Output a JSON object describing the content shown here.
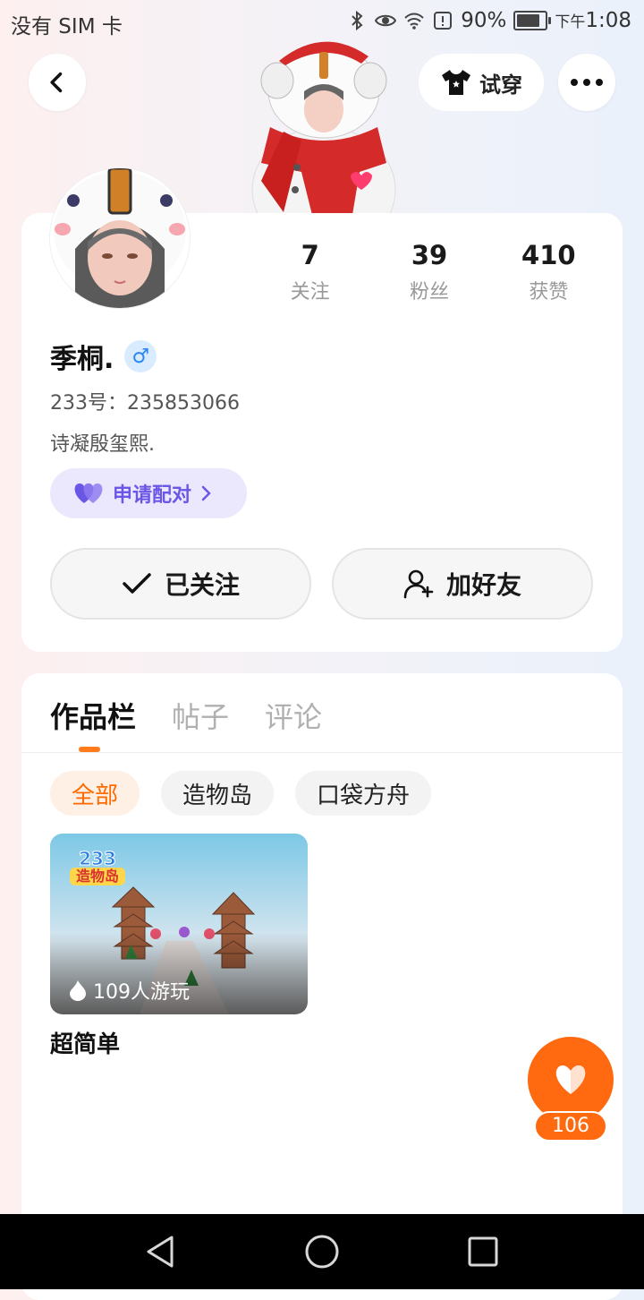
{
  "status_bar": {
    "carrier": "没有 SIM 卡",
    "battery_pct": "90%",
    "battery_level": 0.9,
    "time_prefix": "下午",
    "time": "1:08",
    "icons": [
      "bluetooth-icon",
      "eye-icon",
      "wifi-icon",
      "alert-icon",
      "battery-icon"
    ]
  },
  "header": {
    "try_on_label": "试穿"
  },
  "profile": {
    "stats": [
      {
        "value": "7",
        "label": "关注"
      },
      {
        "value": "39",
        "label": "粉丝"
      },
      {
        "value": "410",
        "label": "获赞"
      }
    ],
    "name": "季桐.",
    "gender_symbol": "♂",
    "uid": "233号：235853066",
    "bio": "诗凝殷玺熙.",
    "pair_label": "申请配对",
    "follow_label": "已关注",
    "add_friend_label": "加好友"
  },
  "works": {
    "tabs": [
      "作品栏",
      "帖子",
      "评论"
    ],
    "active_tab": 0,
    "filters": [
      "全部",
      "造物岛",
      "口袋方舟"
    ],
    "active_filter": 0,
    "items": [
      {
        "players": "109人游玩",
        "title": "超简单",
        "badge_top": "233",
        "badge_bottom": "造物岛"
      }
    ]
  },
  "like_fab": {
    "count": "106"
  },
  "colors": {
    "accent": "#ff6a10",
    "pair_purple": "#6b57e6",
    "gender_blue": "#2b86f0"
  }
}
